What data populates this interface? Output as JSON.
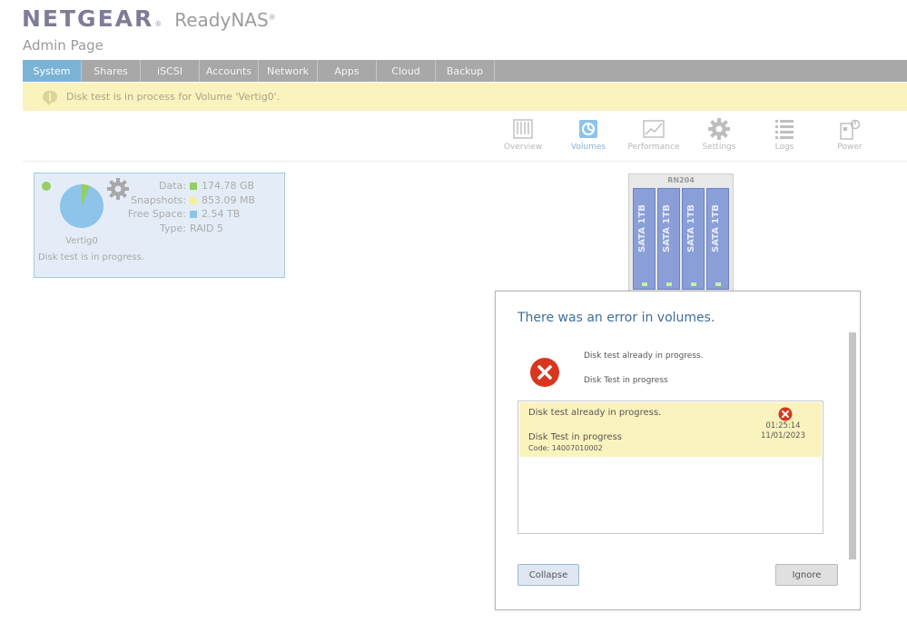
{
  "brand": {
    "logo": "NETGEAR",
    "logo_mark": "®",
    "product": "ReadyNAS",
    "product_mark": "®",
    "subtitle": "Admin Page"
  },
  "nav": {
    "tabs": [
      {
        "label": "System",
        "active": true
      },
      {
        "label": "Shares"
      },
      {
        "label": "iSCSI"
      },
      {
        "label": "Accounts"
      },
      {
        "label": "Network"
      },
      {
        "label": "Apps"
      },
      {
        "label": "Cloud"
      },
      {
        "label": "Backup"
      }
    ]
  },
  "notification": {
    "text": "Disk test is in process for Volume 'Vertig0'.",
    "icon": "speech-bubble-icon"
  },
  "subtabs": [
    {
      "label": "Overview",
      "icon": "overview-icon"
    },
    {
      "label": "Volumes",
      "icon": "volumes-icon",
      "active": true
    },
    {
      "label": "Performance",
      "icon": "performance-icon"
    },
    {
      "label": "Settings",
      "icon": "settings-icon"
    },
    {
      "label": "Logs",
      "icon": "logs-icon"
    },
    {
      "label": "Power",
      "icon": "power-icon"
    }
  ],
  "volume": {
    "name": "Vertig0",
    "status": "Disk test is in progress.",
    "usage_fraction": 0.06,
    "stats": {
      "data_label": "Data:",
      "data_value": "174.78 GB",
      "snapshots_label": "Snapshots:",
      "snapshots_value": "853.09 MB",
      "free_label": "Free Space:",
      "free_value": "2.54 TB",
      "type_label": "Type:",
      "type_value": "RAID 5"
    }
  },
  "device": {
    "model": "RN204",
    "bays": [
      "SATA 1TB",
      "SATA 1TB",
      "SATA 1TB",
      "SATA 1TB"
    ]
  },
  "dialog": {
    "title": "There was an error in volumes.",
    "message1": "Disk test already in progress.",
    "message2": "Disk Test in progress",
    "entry": {
      "line1": "Disk test already in progress.",
      "line2": "Disk Test in progress",
      "code": "Code: 14007010002",
      "time": "01:25:14",
      "date": "11/01/2023"
    },
    "collapse_label": "Collapse",
    "ignore_label": "Ignore"
  },
  "colors": {
    "nav_active": "#7bb3d6",
    "nav_bg": "#a8a8a8",
    "notify_bg": "#fbf3be",
    "status_ok": "#93cf61",
    "error": "#d9361e",
    "data_color": "#93cf61",
    "snapshot_color": "#f3ef9c",
    "free_color": "#8ec3ea"
  }
}
